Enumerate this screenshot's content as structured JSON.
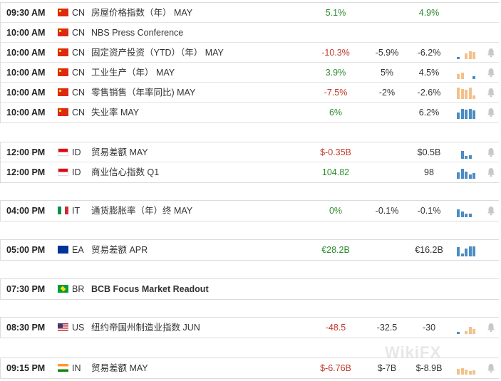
{
  "colors": {
    "positive": "#2e8b2e",
    "negative": "#c0392b",
    "bar_blue": "#4a8cc4",
    "bar_orange": "#f3c08a",
    "border": "#dcdcdc"
  },
  "groups": [
    {
      "rows": [
        {
          "time": "09:30 AM",
          "flag": "cn",
          "country": "CN",
          "event": "房屋价格指数（年） MAY",
          "actual": "5.1%",
          "actual_tone": "green",
          "forecast": "",
          "previous": "4.9%",
          "previous_tone": "green",
          "bars": [],
          "bell": false
        },
        {
          "time": "10:00 AM",
          "flag": "cn",
          "country": "CN",
          "event": "NBS Press Conference",
          "actual": "",
          "actual_tone": "dark",
          "forecast": "",
          "previous": "",
          "previous_tone": "dark",
          "bars": [],
          "bell": false
        },
        {
          "time": "10:00 AM",
          "flag": "cn",
          "country": "CN",
          "event": "固定资产投资（YTD）（年） MAY",
          "actual": "-10.3%",
          "actual_tone": "red",
          "forecast": "-5.9%",
          "previous": "-6.2%",
          "previous_tone": "dark",
          "bars": [
            {
              "v": 0.15,
              "c": "blue"
            },
            {
              "v": 0.0,
              "c": "none"
            },
            {
              "v": 0.45,
              "c": "orange"
            },
            {
              "v": 0.6,
              "c": "orange"
            },
            {
              "v": 0.55,
              "c": "orange"
            }
          ],
          "bell": true
        },
        {
          "time": "10:00 AM",
          "flag": "cn",
          "country": "CN",
          "event": "工业生产（年） MAY",
          "actual": "3.9%",
          "actual_tone": "green",
          "forecast": "5%",
          "previous": "4.5%",
          "previous_tone": "dark",
          "bars": [
            {
              "v": 0.4,
              "c": "orange"
            },
            {
              "v": 0.5,
              "c": "orange"
            },
            {
              "v": 0.0,
              "c": "none"
            },
            {
              "v": 0.0,
              "c": "none"
            },
            {
              "v": 0.2,
              "c": "blue"
            }
          ],
          "bell": true
        },
        {
          "time": "10:00 AM",
          "flag": "cn",
          "country": "CN",
          "event": "零售销售（年率同比) MAY",
          "actual": "-7.5%",
          "actual_tone": "red",
          "forecast": "-2%",
          "previous": "-2.6%",
          "previous_tone": "dark",
          "bars": [
            {
              "v": 0.9,
              "c": "orange"
            },
            {
              "v": 0.8,
              "c": "orange"
            },
            {
              "v": 0.7,
              "c": "orange"
            },
            {
              "v": 0.9,
              "c": "orange"
            },
            {
              "v": 0.3,
              "c": "orange"
            }
          ],
          "bell": true
        },
        {
          "time": "10:00 AM",
          "flag": "cn",
          "country": "CN",
          "event": "失业率 MAY",
          "actual": "6%",
          "actual_tone": "green",
          "forecast": "",
          "previous": "6.2%",
          "previous_tone": "dark",
          "bars": [
            {
              "v": 0.5,
              "c": "blue"
            },
            {
              "v": 0.8,
              "c": "blue"
            },
            {
              "v": 0.7,
              "c": "blue"
            },
            {
              "v": 0.75,
              "c": "blue"
            },
            {
              "v": 0.65,
              "c": "blue"
            }
          ],
          "bell": true
        }
      ]
    },
    {
      "rows": [
        {
          "time": "12:00 PM",
          "flag": "id",
          "country": "ID",
          "event": "贸易差额 MAY",
          "actual": "$-0.35B",
          "actual_tone": "red",
          "forecast": "",
          "previous": "$0.5B",
          "previous_tone": "dark",
          "bars": [
            {
              "v": 0.0,
              "c": "none"
            },
            {
              "v": 0.6,
              "c": "blue"
            },
            {
              "v": 0.2,
              "c": "blue"
            },
            {
              "v": 0.25,
              "c": "blue"
            },
            {
              "v": 0.0,
              "c": "none"
            }
          ],
          "bell": true
        },
        {
          "time": "12:00 PM",
          "flag": "id",
          "country": "ID",
          "event": "商业信心指数 Q1",
          "actual": "104.82",
          "actual_tone": "green",
          "forecast": "",
          "previous": "98",
          "previous_tone": "dark",
          "bars": [
            {
              "v": 0.5,
              "c": "blue"
            },
            {
              "v": 0.8,
              "c": "blue"
            },
            {
              "v": 0.55,
              "c": "blue"
            },
            {
              "v": 0.35,
              "c": "blue"
            },
            {
              "v": 0.45,
              "c": "blue"
            }
          ],
          "bell": true
        }
      ]
    },
    {
      "rows": [
        {
          "time": "04:00 PM",
          "flag": "it",
          "country": "IT",
          "event": "通货膨胀率（年）终 MAY",
          "actual": "0%",
          "actual_tone": "green",
          "forecast": "-0.1%",
          "previous": "-0.1%",
          "previous_tone": "dark",
          "bars": [
            {
              "v": 0.6,
              "c": "blue"
            },
            {
              "v": 0.45,
              "c": "blue"
            },
            {
              "v": 0.3,
              "c": "blue"
            },
            {
              "v": 0.25,
              "c": "blue"
            },
            {
              "v": 0.0,
              "c": "none"
            }
          ],
          "bell": true
        }
      ]
    },
    {
      "rows": [
        {
          "time": "05:00 PM",
          "flag": "ea",
          "country": "EA",
          "event": "贸易差额 APR",
          "actual": "€28.2B",
          "actual_tone": "green",
          "forecast": "",
          "previous": "€16.2B",
          "previous_tone": "dark",
          "bars": [
            {
              "v": 0.7,
              "c": "blue"
            },
            {
              "v": 0.2,
              "c": "blue"
            },
            {
              "v": 0.6,
              "c": "blue"
            },
            {
              "v": 0.75,
              "c": "blue"
            },
            {
              "v": 0.8,
              "c": "blue"
            }
          ],
          "bell": false
        }
      ]
    },
    {
      "rows": [
        {
          "time": "07:30 PM",
          "flag": "br",
          "country": "BR",
          "event": "BCB Focus Market Readout",
          "event_bold": true,
          "actual": "",
          "actual_tone": "dark",
          "forecast": "",
          "previous": "",
          "previous_tone": "dark",
          "bars": [],
          "bell": false
        }
      ]
    },
    {
      "rows": [
        {
          "time": "08:30 PM",
          "flag": "us",
          "country": "US",
          "event": "纽约帝国州制造业指数 JUN",
          "actual": "-48.5",
          "actual_tone": "red",
          "forecast": "-32.5",
          "previous": "-30",
          "previous_tone": "dark",
          "bars": [
            {
              "v": 0.15,
              "c": "blue"
            },
            {
              "v": 0.0,
              "c": "none"
            },
            {
              "v": 0.2,
              "c": "orange"
            },
            {
              "v": 0.55,
              "c": "orange"
            },
            {
              "v": 0.4,
              "c": "orange"
            }
          ],
          "bell": true
        }
      ]
    },
    {
      "rows": [
        {
          "time": "09:15 PM",
          "flag": "in",
          "country": "IN",
          "event": "贸易差额 MAY",
          "actual": "$-6.76B",
          "actual_tone": "red",
          "forecast": "$-7B",
          "previous": "$-8.9B",
          "previous_tone": "dark",
          "bars": [
            {
              "v": 0.45,
              "c": "orange"
            },
            {
              "v": 0.5,
              "c": "orange"
            },
            {
              "v": 0.4,
              "c": "orange"
            },
            {
              "v": 0.3,
              "c": "orange"
            },
            {
              "v": 0.35,
              "c": "orange"
            }
          ],
          "bell": true
        }
      ]
    }
  ],
  "watermark": "WikiFX"
}
